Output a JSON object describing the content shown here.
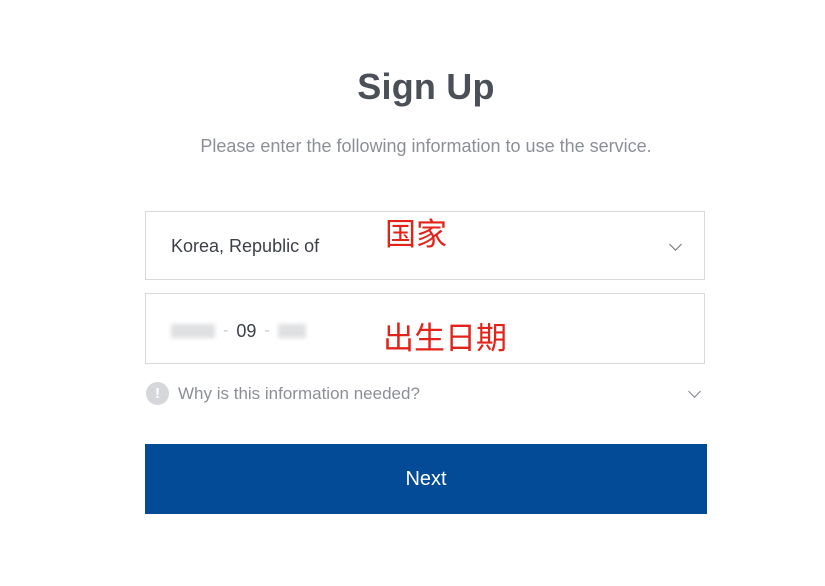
{
  "header": {
    "title": "Sign Up",
    "subtitle": "Please enter the following information to use the service."
  },
  "country_select": {
    "value": "Korea, Republic of",
    "icon": "chevron-down-icon"
  },
  "birthdate_field": {
    "month": "09",
    "separator": "-"
  },
  "annotations": {
    "country": "国家",
    "birthdate": "出生日期",
    "color": "#e2231a"
  },
  "info": {
    "icon_text": "!",
    "text": "Why is this information needed?",
    "icon": "chevron-down-icon"
  },
  "next_button": {
    "label": "Next",
    "color": "#034a97"
  }
}
